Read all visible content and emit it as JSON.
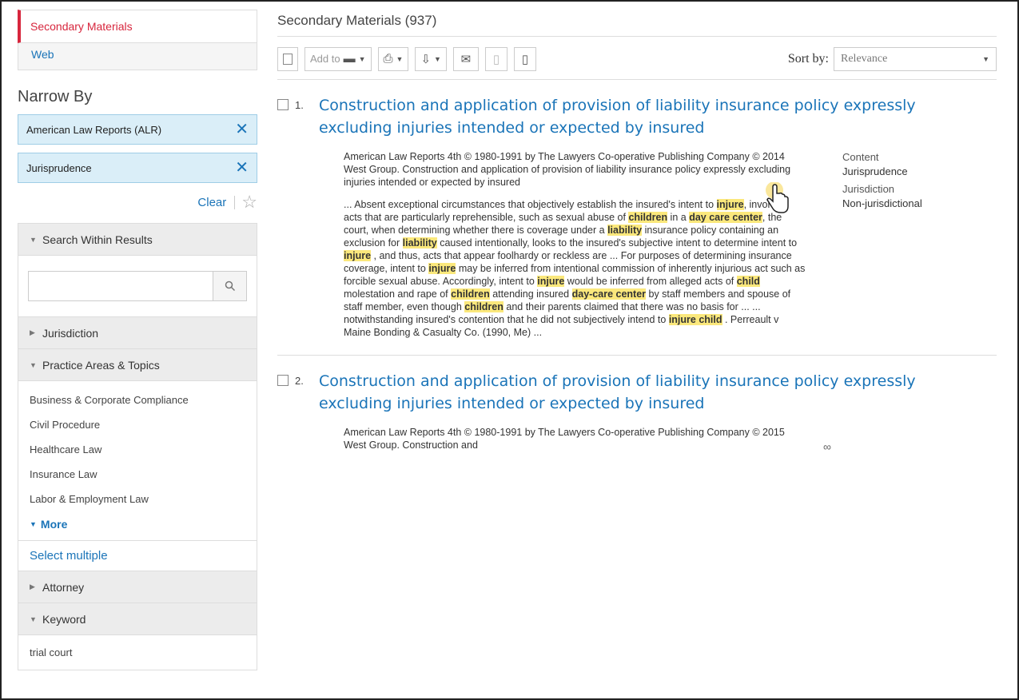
{
  "sidebar": {
    "tabs": [
      "Secondary Materials",
      "Web"
    ],
    "narrow_title": "Narrow By",
    "filters": [
      "American Law Reports (ALR)",
      "Jurisprudence"
    ],
    "filter_remove_glyph": "✕",
    "clear_label": "Clear",
    "search_within_label": "Search Within Results",
    "search_placeholder": "",
    "jurisdiction_label": "Jurisdiction",
    "practice_areas_label": "Practice Areas & Topics",
    "topics": [
      "Business & Corporate Compliance",
      "Civil Procedure",
      "Healthcare Law",
      "Insurance Law",
      "Labor & Employment Law"
    ],
    "more_label": "More",
    "select_multiple_label": "Select multiple",
    "attorney_label": "Attorney",
    "keyword_label": "Keyword",
    "keyword_items": [
      "trial court"
    ]
  },
  "main": {
    "results_title": "Secondary Materials (937)",
    "toolbar": {
      "add_to_label": "Add to"
    },
    "sort_label": "Sort by:",
    "sort_value": "Relevance",
    "results": [
      {
        "number": "1.",
        "title": "Construction and application of provision of liability insurance policy expressly excluding injuries intended or expected by insured",
        "citation": "American Law Reports 4th © 1980-1991 by The Lawyers Co-operative Publishing Company © 2014 West Group. Construction and application of provision of liability insurance policy expressly excluding injuries intended or expected by insured",
        "meta_content_label": "Content",
        "meta_content_value": "Jurisprudence",
        "meta_jurisdiction_label": "Jurisdiction",
        "meta_jurisdiction_value": "Non-jurisdictional",
        "excerpt_parts": [
          {
            "t": "... Absent exceptional circumstances that objectively establish the insured's intent to "
          },
          {
            "t": "injure",
            "h": true
          },
          {
            "t": ", involving acts that are particularly reprehensible, such as sexual abuse of "
          },
          {
            "t": "children",
            "h": true
          },
          {
            "t": " in a "
          },
          {
            "t": "day care center",
            "h": true
          },
          {
            "t": ", the court, when determining whether there is coverage under a "
          },
          {
            "t": "liability",
            "h": true
          },
          {
            "t": " insurance policy containing an exclusion for "
          },
          {
            "t": "liability",
            "h": true
          },
          {
            "t": " caused intentionally, looks to the insured's subjective intent to determine intent to "
          },
          {
            "t": "injure",
            "h": true
          },
          {
            "t": " , and thus, acts that appear foolhardy or reckless are ... For purposes of determining insurance coverage, intent to "
          },
          {
            "t": "injure",
            "h": true
          },
          {
            "t": " may be inferred from intentional commission of inherently injurious act such as forcible sexual abuse. Accordingly, intent to "
          },
          {
            "t": "injure",
            "h": true
          },
          {
            "t": " would be inferred from alleged acts of "
          },
          {
            "t": "child",
            "h": true
          },
          {
            "t": " molestation and rape of "
          },
          {
            "t": "children",
            "h": true
          },
          {
            "t": " attending insured "
          },
          {
            "t": "day-care center",
            "h": true
          },
          {
            "t": " by staff members and spouse of staff member, even though "
          },
          {
            "t": "children",
            "h": true
          },
          {
            "t": " and their parents claimed that there was no basis for ... ... notwithstanding insured's contention that he did not subjectively intend to "
          },
          {
            "t": "injure child",
            "h": true
          },
          {
            "t": " . Perreault v Maine Bonding & Casualty Co. (1990, Me) ..."
          }
        ]
      },
      {
        "number": "2.",
        "title": "Construction and application of provision of liability insurance policy expressly excluding injuries intended or expected by insured",
        "citation": "American Law Reports 4th © 1980-1991 by The Lawyers Co-operative Publishing Company © 2015 West Group. Construction and"
      }
    ]
  },
  "colors": {
    "accent_red": "#d7263d",
    "link_blue": "#1a74b8",
    "highlight": "#fbe87c",
    "chip_bg": "#daeef8"
  },
  "icons": {
    "remove": "close-icon",
    "favorite": "star-icon",
    "search": "search-icon",
    "folder": "folder-icon",
    "print": "print-icon",
    "download": "download-icon",
    "email": "email-icon",
    "preview": "glasses-icon",
    "pointer": "hand-cursor-icon"
  }
}
